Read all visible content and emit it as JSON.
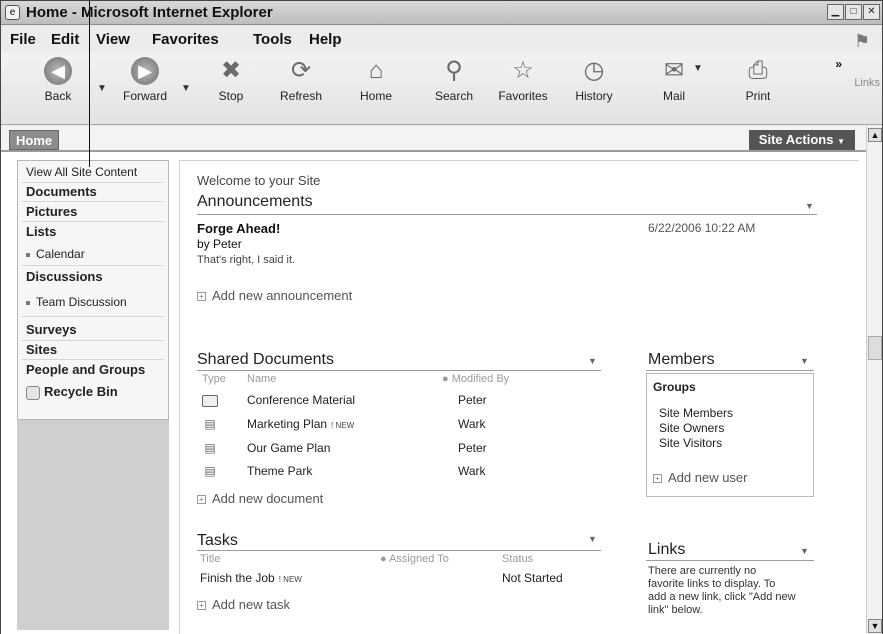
{
  "window": {
    "title": "Home - Microsoft Internet Explorer",
    "controls": [
      "minimize",
      "maximize",
      "close"
    ]
  },
  "menu": {
    "items": [
      {
        "label": "File",
        "underline": "F"
      },
      {
        "label": "Edit",
        "underline": "E"
      },
      {
        "label": "View",
        "underline": "V"
      },
      {
        "label": "Favorites",
        "underline": "a"
      },
      {
        "label": "Tools",
        "underline": "T"
      },
      {
        "label": "Help",
        "underline": "H"
      }
    ]
  },
  "toolbar": {
    "buttons": [
      {
        "label": "Back",
        "icon": "back-arrow-icon"
      },
      {
        "label": "Forward",
        "icon": "forward-arrow-icon"
      },
      {
        "label": "Stop",
        "icon": "stop-icon"
      },
      {
        "label": "Refresh",
        "icon": "refresh-icon"
      },
      {
        "label": "Home",
        "icon": "home-icon"
      },
      {
        "label": "Search",
        "icon": "search-icon"
      },
      {
        "label": "Favorites",
        "icon": "star-icon"
      },
      {
        "label": "History",
        "icon": "history-icon"
      },
      {
        "label": "Mail",
        "icon": "mail-icon"
      },
      {
        "label": "Print",
        "icon": "print-icon"
      }
    ],
    "overflow": "»",
    "links_label": "Links"
  },
  "page": {
    "home_tab": "Home",
    "site_actions": "Site Actions",
    "site_actions_arrow": "▼",
    "welcome": "Welcome to your Site"
  },
  "nav": {
    "view_all": "View All Site Content",
    "documents": "Documents",
    "pictures": "Pictures",
    "lists": "Lists",
    "calendar": "Calendar",
    "discussions": "Discussions",
    "team_discussion": "Team Discussion",
    "surveys": "Surveys",
    "sites": "Sites",
    "people_groups": "People and Groups",
    "recycle_bin": "Recycle Bin"
  },
  "announcements": {
    "title": "Announcements",
    "item_title": "Forge Ahead!",
    "item_by": "by Peter",
    "item_body": "That's right, I said it.",
    "item_date": "6/22/2006 10:22 AM",
    "add_link": "Add new announcement"
  },
  "shared_documents": {
    "title": "Shared Documents",
    "columns": {
      "type": "Type",
      "name": "Name",
      "modified_by": "Modified By"
    },
    "rows": [
      {
        "type": "folder",
        "name": "Conference Material",
        "new": "",
        "modified_by": "Peter"
      },
      {
        "type": "doc",
        "name": "Marketing Plan",
        "new": "! NEW",
        "modified_by": "Wark"
      },
      {
        "type": "doc",
        "name": "Our Game Plan",
        "new": "",
        "modified_by": "Peter"
      },
      {
        "type": "doc",
        "name": "Theme Park",
        "new": "",
        "modified_by": "Wark"
      }
    ],
    "add_link": "Add new document"
  },
  "tasks": {
    "title": "Tasks",
    "columns": {
      "title": "Title",
      "assigned_to": "Assigned To",
      "status": "Status"
    },
    "rows": [
      {
        "title": "Finish the Job",
        "new": "! NEW",
        "assigned_to": "",
        "status": "Not Started"
      }
    ],
    "add_link": "Add new task"
  },
  "members": {
    "title": "Members",
    "groups_label": "Groups",
    "groups": [
      "Site Members",
      "Site Owners",
      "Site Visitors"
    ],
    "add_link": "Add new user"
  },
  "links": {
    "title": "Links",
    "empty_text_1": "There are currently no",
    "empty_text_2": "favorite links to display. To",
    "empty_text_3": "add a new link, click \"Add new",
    "empty_text_4": "link\" below."
  }
}
